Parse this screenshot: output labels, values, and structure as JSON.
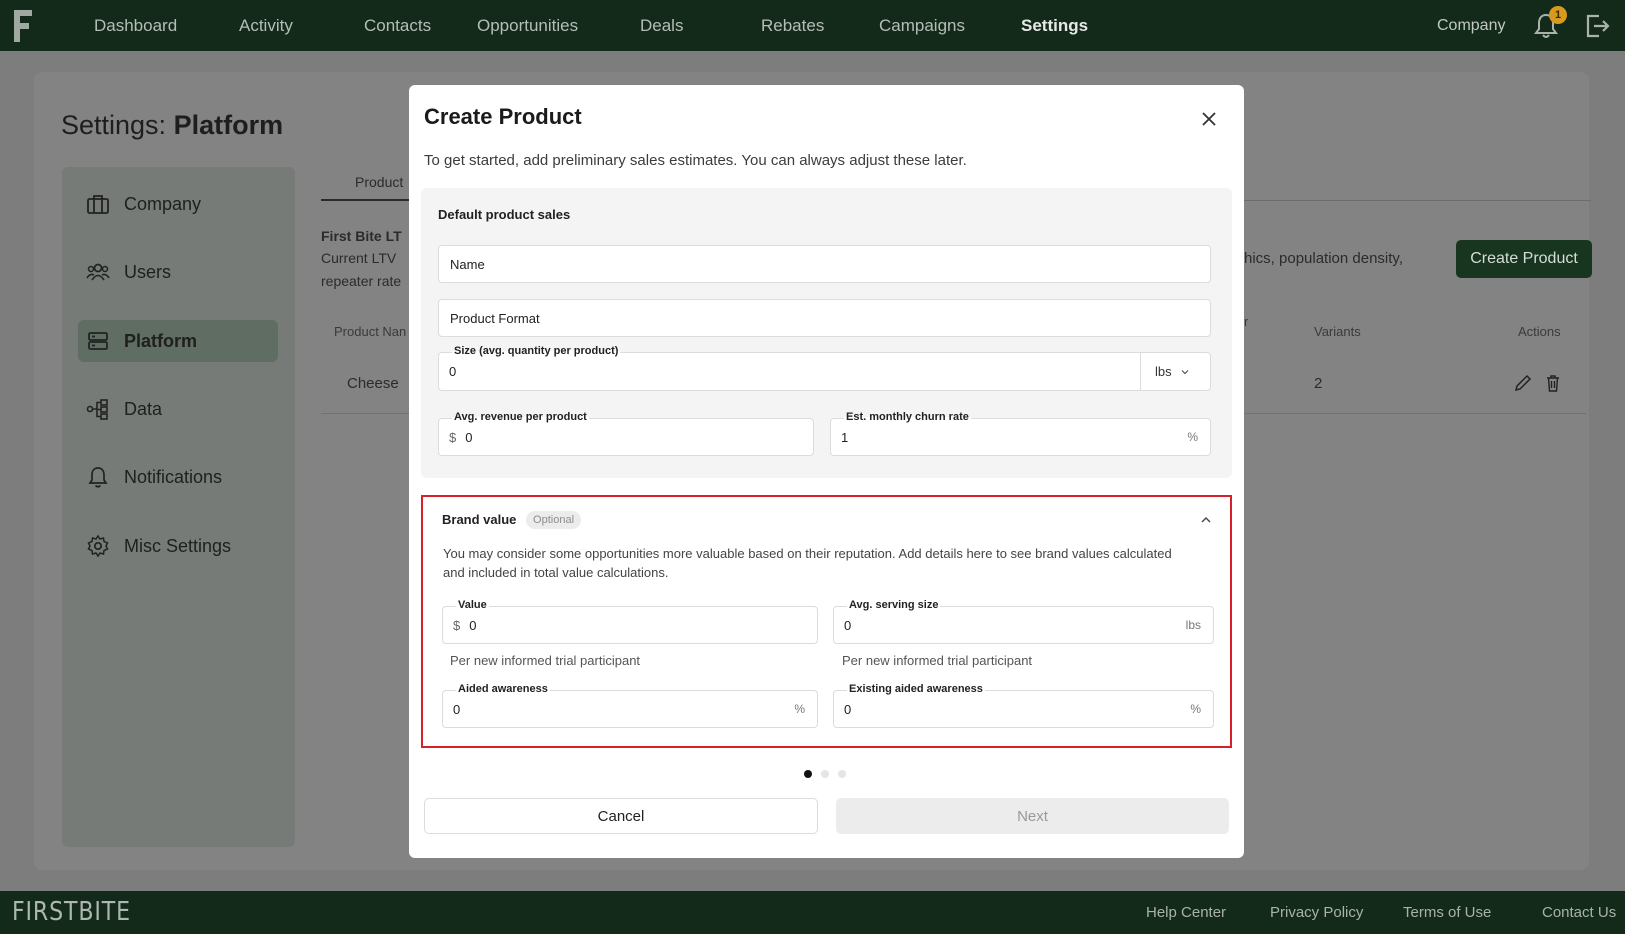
{
  "nav": {
    "items": [
      {
        "label": "Dashboard",
        "active": false
      },
      {
        "label": "Activity",
        "active": false
      },
      {
        "label": "Contacts",
        "active": false
      },
      {
        "label": "Opportunities",
        "active": false
      },
      {
        "label": "Deals",
        "active": false
      },
      {
        "label": "Rebates",
        "active": false
      },
      {
        "label": "Campaigns",
        "active": false
      },
      {
        "label": "Settings",
        "active": true
      }
    ],
    "company": "Company",
    "notification_count": "1"
  },
  "page": {
    "title_prefix": "Settings:",
    "title_bold": "Platform",
    "sidebar": [
      {
        "label": "Company",
        "icon": "briefcase-icon"
      },
      {
        "label": "Users",
        "icon": "users-icon"
      },
      {
        "label": "Platform",
        "icon": "server-icon",
        "active": true
      },
      {
        "label": "Data",
        "icon": "data-flow-icon"
      },
      {
        "label": "Notifications",
        "icon": "bell-icon"
      },
      {
        "label": "Misc Settings",
        "icon": "gear-icon"
      }
    ],
    "tab_label": "Product",
    "ltv_title": "First Bite LT",
    "ltv_line1": "Current LTV",
    "ltv_line2": "repeater rate",
    "ltv_right": "hics, population density,",
    "create_button": "Create Product",
    "table_headers": {
      "product_name": "Product Nan",
      "variants": "Variants",
      "actions": "Actions",
      "partial": "r"
    },
    "rows": [
      {
        "product_name": "Cheese",
        "variants": "2"
      }
    ]
  },
  "modal": {
    "title": "Create Product",
    "subtitle": "To get started, add preliminary sales estimates. You can always adjust these later.",
    "default_section_title": "Default product sales",
    "name_placeholder": "Name",
    "format_placeholder": "Product Format",
    "size_label": "Size (avg. quantity per product)",
    "size_value": "0",
    "size_unit": "lbs",
    "revenue_label": "Avg. revenue per product",
    "revenue_prefix": "$",
    "revenue_value": "0",
    "churn_label": "Est. monthly churn rate",
    "churn_value": "1",
    "churn_suffix": "%",
    "brand": {
      "title": "Brand value",
      "badge": "Optional",
      "description": "You may consider some opportunities more valuable based on their reputation. Add details here to see brand values calculated and included in total value calculations.",
      "value_label": "Value",
      "value_prefix": "$",
      "value_value": "0",
      "value_helper": "Per new informed trial participant",
      "serving_label": "Avg. serving size",
      "serving_value": "0",
      "serving_suffix": "lbs",
      "serving_helper": "Per new informed trial participant",
      "aided_label": "Aided awareness",
      "aided_value": "0",
      "aided_suffix": "%",
      "existing_label": "Existing aided awareness",
      "existing_value": "0",
      "existing_suffix": "%"
    },
    "step": {
      "current": 1,
      "total": 3
    },
    "cancel": "Cancel",
    "next": "Next"
  },
  "footer": {
    "logo": "FIRSTBITE",
    "links": [
      "Help Center",
      "Privacy Policy",
      "Terms of Use",
      "Contact Us"
    ]
  },
  "colors": {
    "nav_bg": "#132a1a",
    "highlight_border": "#d6202a",
    "badge": "#d79a1e"
  }
}
